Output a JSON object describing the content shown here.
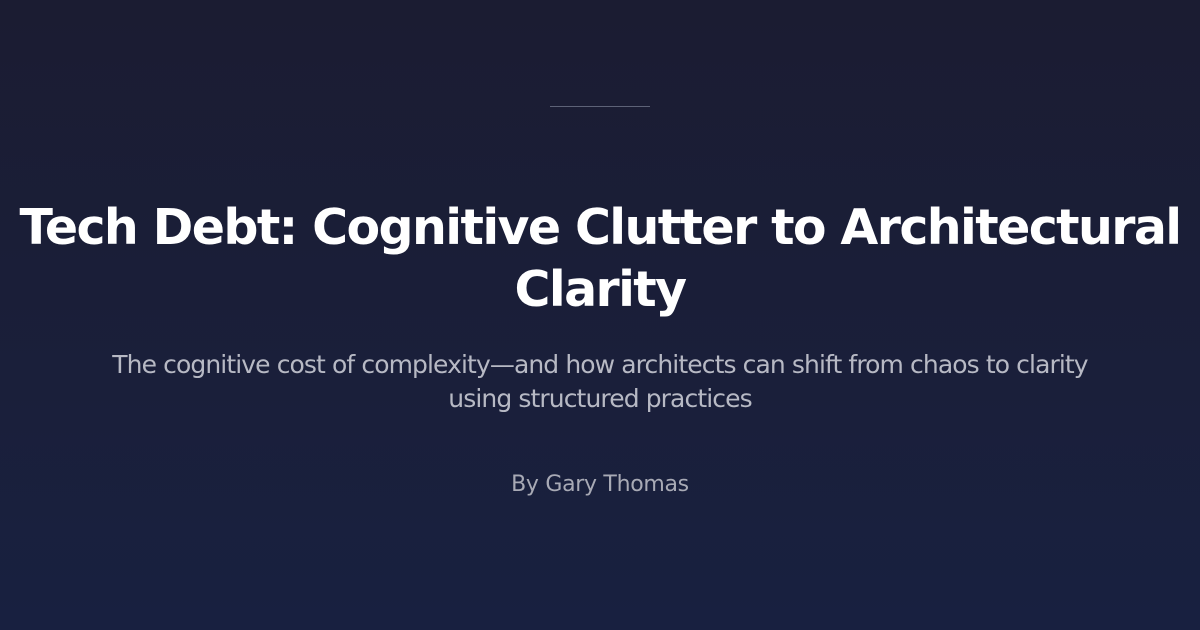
{
  "article": {
    "title_line1": "Tech Debt: Cognitive Clutter to Architectural",
    "title_line2": "Clarity",
    "subtitle_line1": "The cognitive cost of complexity—and how architects can shift from chaos to clarity",
    "subtitle_line2": "using structured practices",
    "byline": "By Gary Thomas"
  },
  "colors": {
    "background_top": "#1b1c32",
    "background_bottom": "#182040",
    "title": "#ffffff",
    "subtitle": "#b7b9c4",
    "byline": "#a8aab5",
    "divider": "#5d6277"
  }
}
